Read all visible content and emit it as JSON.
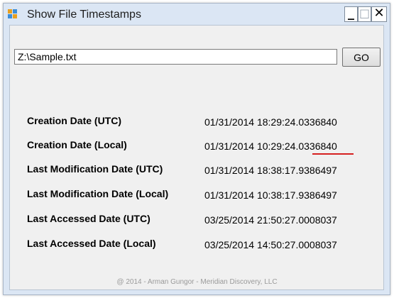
{
  "window": {
    "title": "Show File Timestamps",
    "minimize_glyph": "_",
    "maximize_glyph": "□",
    "close_glyph": "✕",
    "icon": "app-window-icon"
  },
  "path_input": {
    "value": "Z:\\Sample.txt"
  },
  "go_button": {
    "label": "GO"
  },
  "timestamps": [
    {
      "label": "Creation Date (UTC)",
      "value": "01/31/2014 18:29:24.0336840"
    },
    {
      "label": "Creation Date (Local)",
      "value": "01/31/2014 10:29:24.0336840"
    },
    {
      "label": "Last Modification Date (UTC)",
      "value": "01/31/2014 18:38:17.9386497"
    },
    {
      "label": "Last Modification Date (Local)",
      "value": "01/31/2014 10:38:17.9386497"
    },
    {
      "label": "Last Accessed Date (UTC)",
      "value": "03/25/2014 21:50:27.0008037"
    },
    {
      "label": "Last Accessed Date (Local)",
      "value": "03/25/2014 14:50:27.0008037"
    }
  ],
  "footer": {
    "text": "@ 2014 - Arman Gungor - Meridian Discovery, LLC"
  },
  "colors": {
    "underline": "#d62020",
    "title_bar": "#dbe6f4",
    "client": "#f0f0f0"
  }
}
